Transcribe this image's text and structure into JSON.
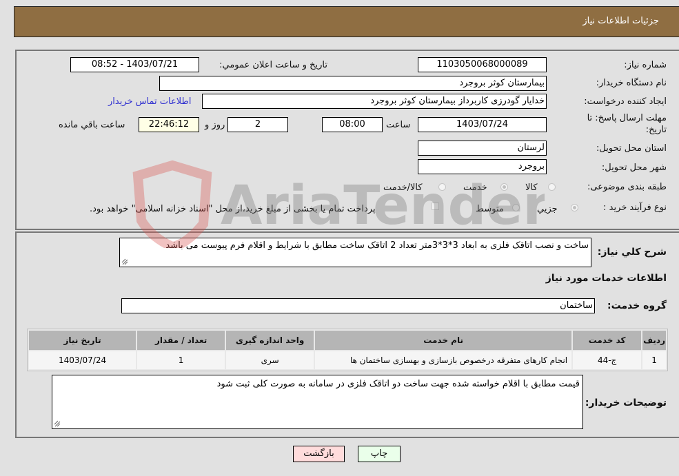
{
  "header": {
    "title": "جزئيات اطلاعات نياز"
  },
  "details": {
    "need_number_label": "شماره نیاز:",
    "need_number": "1103050068000089",
    "announce_label": "تاریخ و ساعت اعلان عمومي:",
    "announce_value": "1403/07/21 - 08:52",
    "buyer_org_label": "نام دستگاه خریدار:",
    "buyer_org": "بیمارستان کوثر بروجرد",
    "requester_label": "ایجاد کننده درخواست:",
    "requester": "خدایار  گودرزی کاربرداز بیمارستان کوثر بروجرد",
    "contact_link": "اطلاعات تماس خریدار",
    "deadline_label": "مهلت ارسال پاسخ: تا تاریخ:",
    "deadline_date": "1403/07/24",
    "time_label": "ساعت",
    "deadline_time": "08:00",
    "days_value": "2",
    "days_label": "روز و",
    "remaining_time": "22:46:12",
    "remaining_label": "ساعت باقي مانده",
    "province_label": "استان محل تحویل:",
    "province": "لرستان",
    "city_label": "شهر محل تحویل:",
    "city": "بروجرد",
    "category_label": "طبقه بندی موضوعی:",
    "category_options": [
      {
        "label": "کالا",
        "selected": false
      },
      {
        "label": "خدمت",
        "selected": true
      },
      {
        "label": "کالا/خدمت",
        "selected": false
      }
    ],
    "process_label": "نوع فرآیند خرید :",
    "process_options": [
      {
        "label": "جزيي",
        "selected": true
      },
      {
        "label": "متوسط",
        "selected": false
      }
    ],
    "treasury_note": "پرداخت تمام یا بخشی از مبلغ خرید،از محل \"اسناد خزانه اسلامی\" خواهد بود.",
    "treasury_checked": false
  },
  "summary": {
    "label": "شرح كلي نياز:",
    "text": "ساخت و نصب اتاقک فلزی به ابعاد 3*3*3متر تعداد 2 اتاقک  ساخت مطابق با شرایط و اقلام فرم پیوست می باشد"
  },
  "services": {
    "section_title": "اطلاعات خدمات مورد نياز",
    "group_label": "گروه خدمت:",
    "group_value": "ساختمان",
    "columns": [
      "ردیف",
      "کد خدمت",
      "نام خدمت",
      "واحد اندازه گیری",
      "تعداد / مقدار",
      "تاریخ نیاز"
    ],
    "rows": [
      [
        "1",
        "ج-44",
        "انجام کارهای متفرقه درخصوص بازسازی و بهسازی ساختمان ها",
        "سری",
        "1",
        "1403/07/24"
      ]
    ]
  },
  "buyer_notes": {
    "label": "توضیحات خریدار:",
    "text": "قیمت مطابق با اقلام خواسته شده جهت ساخت دو اتاقک فلزی در سامانه به صورت کلی ثبت شود"
  },
  "buttons": {
    "print": "چاپ",
    "back": "بازگشت"
  },
  "watermark": {
    "text": "AriaTender.neT",
    "colors": {
      "shield": "#d9534f",
      "text": "#777777"
    }
  }
}
